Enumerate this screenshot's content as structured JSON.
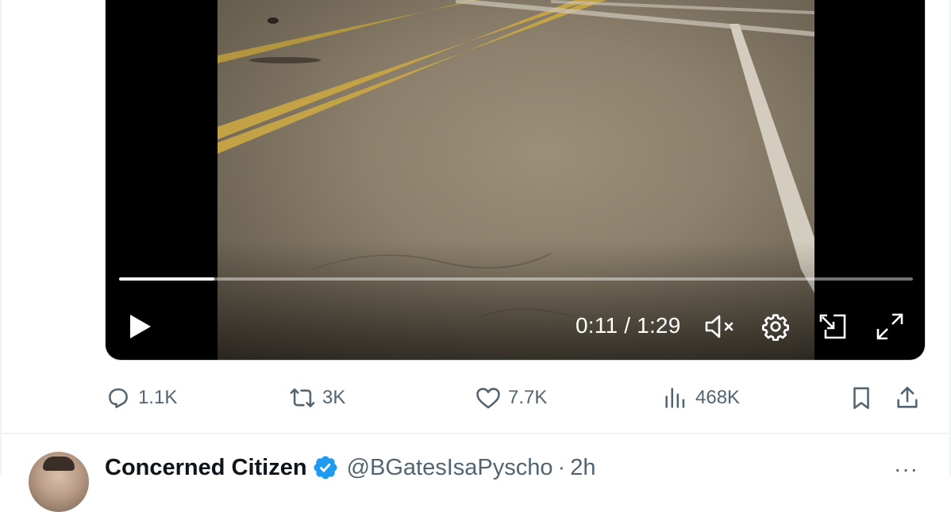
{
  "video": {
    "time_current": "0:11",
    "time_separator": "/",
    "time_total": "1:29",
    "progress": 0.12,
    "controls": {
      "play": "play-icon",
      "mute": "volume-muted-icon",
      "settings": "gear-icon",
      "pip": "picture-in-picture-icon",
      "fullscreen": "fullscreen-icon"
    }
  },
  "actions": {
    "replies": "1.1K",
    "retweets": "3K",
    "likes": "7.7K",
    "views": "468K"
  },
  "next_tweet": {
    "name": "Concerned Citizen",
    "handle": "@BGatesIsaPyscho",
    "separator": "·",
    "time_ago": "2h",
    "more": "···"
  },
  "colors": {
    "muted_text": "#536471",
    "verified_blue": "#1d9bf0"
  }
}
